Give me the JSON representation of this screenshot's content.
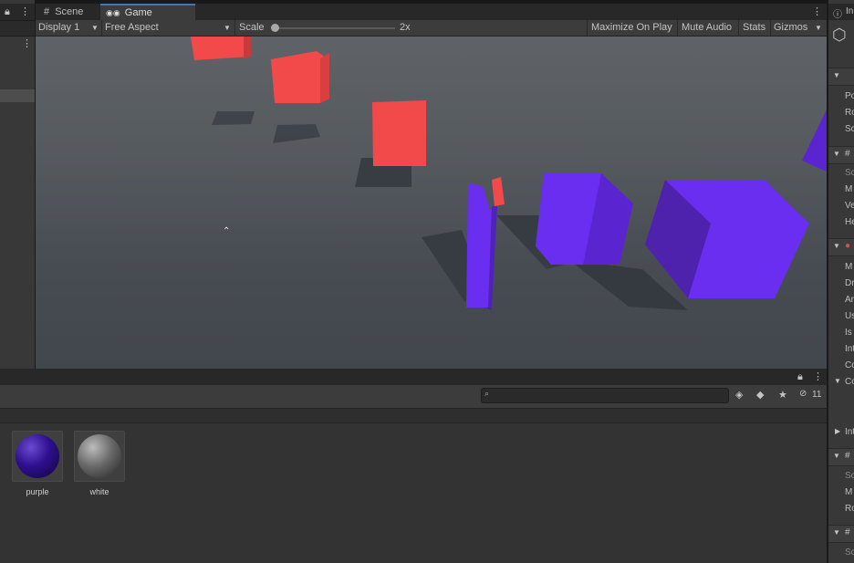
{
  "tabs": {
    "scene": "Scene",
    "game": "Game"
  },
  "toolbar": {
    "display": "Display 1",
    "aspect": "Free Aspect",
    "scale_label": "Scale",
    "scale_value": "2x",
    "maximize": "Maximize On Play",
    "mute": "Mute Audio",
    "stats": "Stats",
    "gizmos": "Gizmos"
  },
  "inspector": {
    "tab": "In",
    "rows": [
      "Po",
      "Ro",
      "Sc",
      "Sc",
      "M",
      "Ve",
      "He",
      "M",
      "Dr",
      "Ar",
      "Us",
      "Is",
      "Int",
      "Co",
      "Co",
      "Int",
      "Sc",
      "M",
      "Ro",
      "Sc"
    ]
  },
  "project": {
    "hidden_count": "11",
    "assets": [
      {
        "name": "purple",
        "color": "#3a1a9e"
      },
      {
        "name": "white",
        "color": "#8a8a8a"
      }
    ]
  },
  "colors": {
    "red_cube": "#f24a4a",
    "purple_cube": "#6a2ef0",
    "accent": "#3a79bb"
  }
}
